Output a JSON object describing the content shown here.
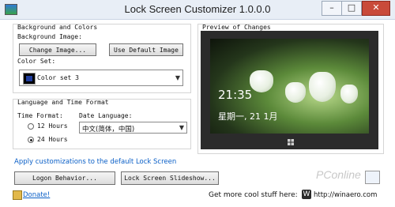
{
  "window": {
    "title": "Lock Screen Customizer 1.0.0.0"
  },
  "background": {
    "group_label": "Background and Colors",
    "image_label": "Background Image:",
    "change_image": "Change Image...",
    "use_default": "Use Default Image",
    "color_set_label": "Color Set:",
    "color_set_value": "Color set 3",
    "color_set_swatch": "#1f3d9e"
  },
  "language": {
    "group_label": "Language and Time Format",
    "time_format_label": "Time Format:",
    "time_12": "12 Hours",
    "time_24": "24 Hours",
    "time_selected": "24 Hours",
    "date_language_label": "Date Language:",
    "date_language_value": "中文(简体，中国)"
  },
  "preview": {
    "label": "Preview of Changes",
    "clock": "21:35",
    "date": "星期一, 21 1月"
  },
  "apply_link": "Apply customizations to the default Lock Screen",
  "buttons": {
    "logon": "Logon Behavior...",
    "slideshow": "Lock Screen Slideshow..."
  },
  "footer": {
    "donate": "Donate!",
    "get_more": "Get more cool stuff here:",
    "url": "http://winaero.com"
  },
  "watermark": "PConline",
  "colors": {
    "link": "#0a5fc7",
    "close_button": "#c94a3a",
    "titlebar": "#e8eef6"
  }
}
